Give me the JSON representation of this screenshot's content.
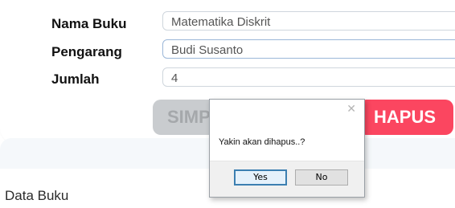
{
  "form": {
    "fields": [
      {
        "label": "Nama Buku",
        "value": "Matematika Diskrit"
      },
      {
        "label": "Pengarang",
        "value": "Budi Susanto"
      },
      {
        "label": "Jumlah",
        "value": "4"
      }
    ]
  },
  "buttons": {
    "simpan": "SIMP",
    "hapus": "HAPUS"
  },
  "section": {
    "title": "Data Buku"
  },
  "dialog": {
    "close_glyph": "✕",
    "message": "Yakin akan dihapus..?",
    "yes": "Yes",
    "no": "No"
  },
  "colors": {
    "hapus": "#fb4660",
    "simpan": "#c9cccf",
    "dialog_default_border": "#3c7fb1"
  }
}
